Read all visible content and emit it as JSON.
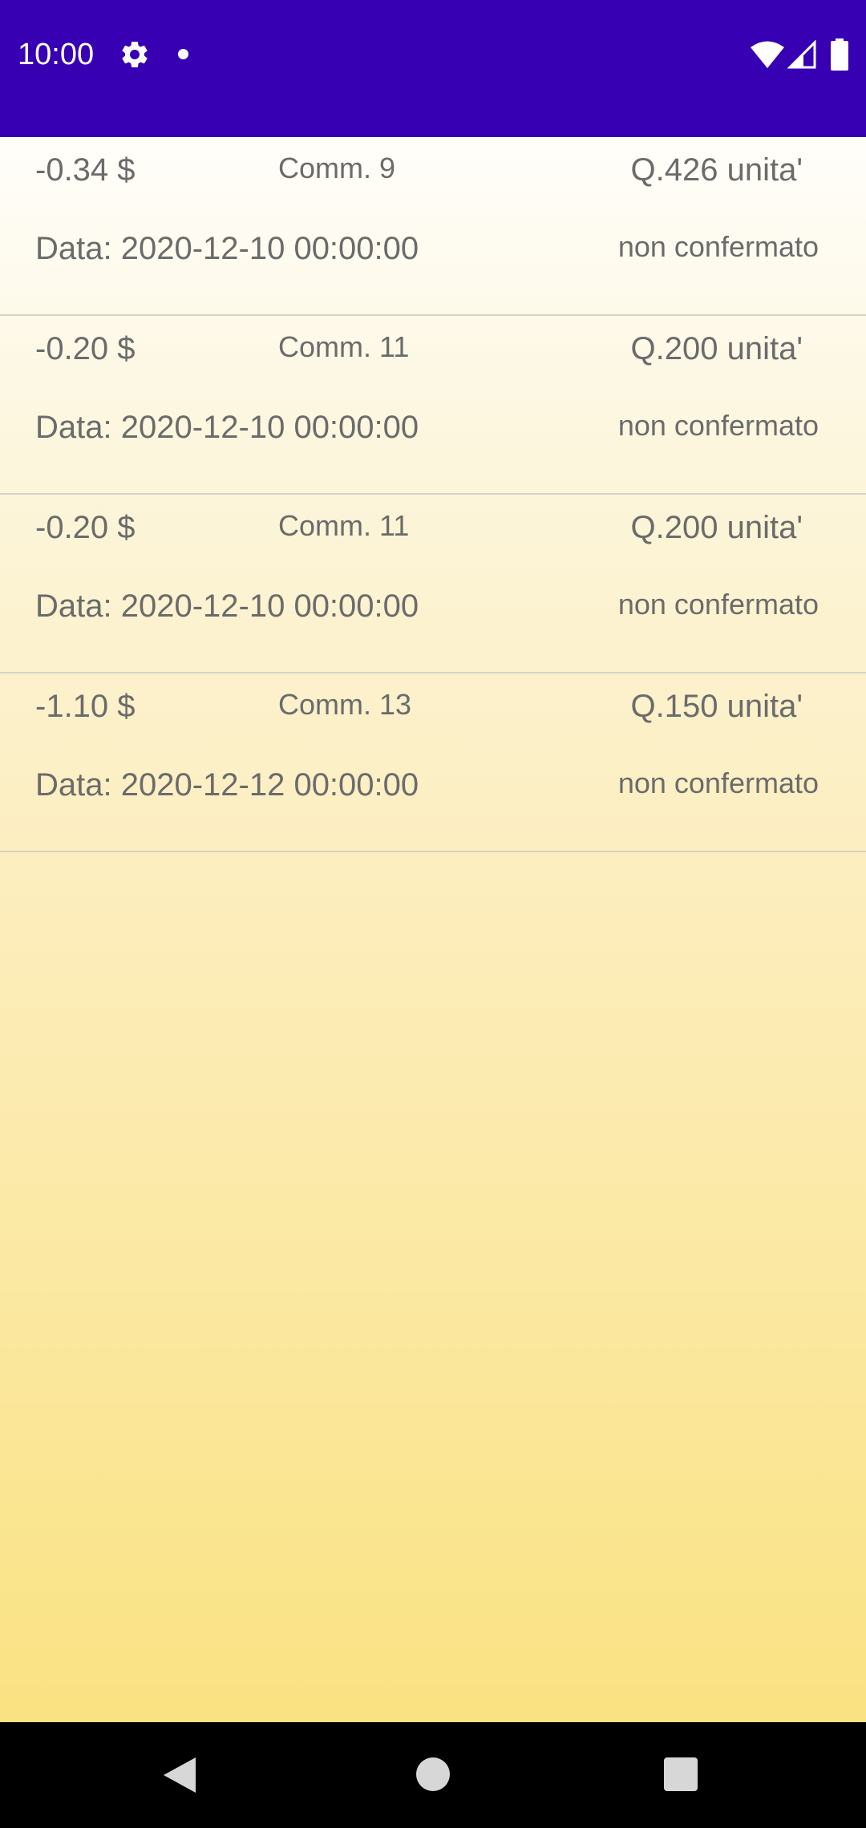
{
  "status_bar": {
    "time": "10:00",
    "background": "#3700b3",
    "icons": [
      "gear-icon",
      "notification-dot-icon",
      "wifi-icon",
      "cell-signal-icon",
      "battery-icon"
    ]
  },
  "orders": [
    {
      "price": "-0.34 $",
      "comm": "Comm. 9",
      "quantity": "Q.426 unita'",
      "date": "Data: 2020-12-10 00:00:00",
      "status": "non confermato"
    },
    {
      "price": "-0.20 $",
      "comm": "Comm. 11",
      "quantity": "Q.200 unita'",
      "date": "Data: 2020-12-10 00:00:00",
      "status": "non confermato"
    },
    {
      "price": "-0.20 $",
      "comm": "Comm. 11",
      "quantity": "Q.200 unita'",
      "date": "Data: 2020-12-10 00:00:00",
      "status": "non confermato"
    },
    {
      "price": "-1.10 $",
      "comm": "Comm. 13",
      "quantity": "Q.150 unita'",
      "date": "Data: 2020-12-12 00:00:00",
      "status": "non confermato"
    }
  ],
  "nav_bar": {
    "icons": [
      "back-icon",
      "home-icon",
      "recents-icon"
    ]
  }
}
